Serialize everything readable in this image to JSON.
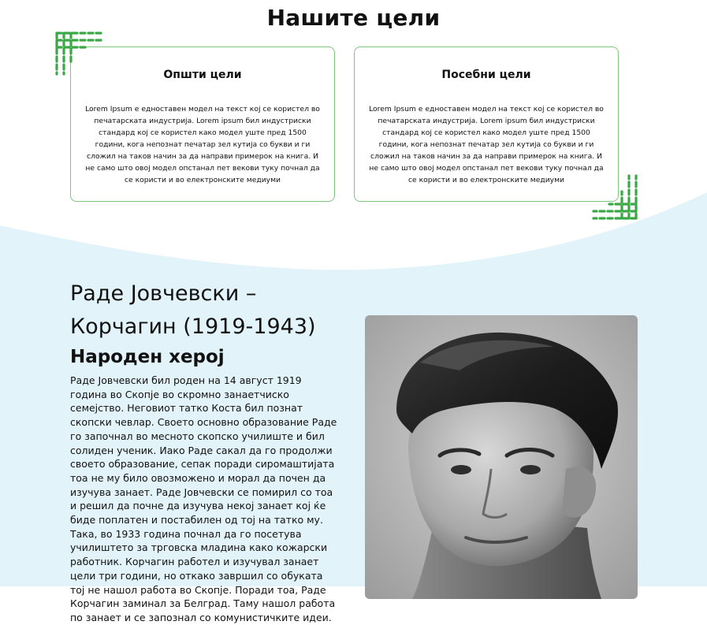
{
  "goals": {
    "title": "Нашите цели",
    "cards": [
      {
        "title": "Општи цели",
        "text": "Lorem Ipsum е едноставен модел на текст кој се користел во печатарската индустрија. Lorem ipsum бил индустриски стандард кој се користел како модел уште пред 1500 години, кога непознат печатар зел кутија со букви и ги сложил на таков начин за да направи примерок на книга. И не само што овој модел опстанал пет векови туку почнал да се користи и во електронските медиуми"
      },
      {
        "title": "Посебни цели",
        "text": "Lorem Ipsum е едноставен модел на текст кој се користел во печатарската индустрија. Lorem ipsum бил индустриски стандард кој се користел како модел уште пред 1500 години, кога непознат печатар зел кутија со букви и ги сложил на таков начин за да направи примерок на книга. И не само што овој модел опстанал пет векови туку почнал да се користи и во електронските медиуми"
      }
    ]
  },
  "hero": {
    "title": "Раде Јовчевски – Корчагин (1919-1943)",
    "subtitle": "Народен херој",
    "bio": "Раде Јовчевски бил роден на 14 август 1919 година во Скопје во скромно занаетчиско семејство. Неговиот татко Коста бил познат скопски чевлар. Своето основно образование Раде го започнал во месното скопско училиште и бил солиден ученик. Иако Раде сакал да го продолжи своето образование, сепак поради сиромаштијата тоа не му било овозможено и морал да почен да изучува занает. Раде Јовчевски се помирил со тоа и решил да почне да изучува некој занает кој ќе биде поплатен и постабилен од тој на татко му. Така, во 1933 година почнал да го посетува училиштето за трговска младина како кожарски работник. Корчагин работел и изучувал занает цели три години, но откако завршил со обуката тој не нашол работа во Скопје. Поради тоа, Раде Корчагин заминал за Белград. Таму нашол работа по занает и се запознал со комунистичките идеи."
  },
  "colors": {
    "accent_green": "#3aa845",
    "card_border": "#7ec67e",
    "wave_blue": "#e2f3fa"
  }
}
